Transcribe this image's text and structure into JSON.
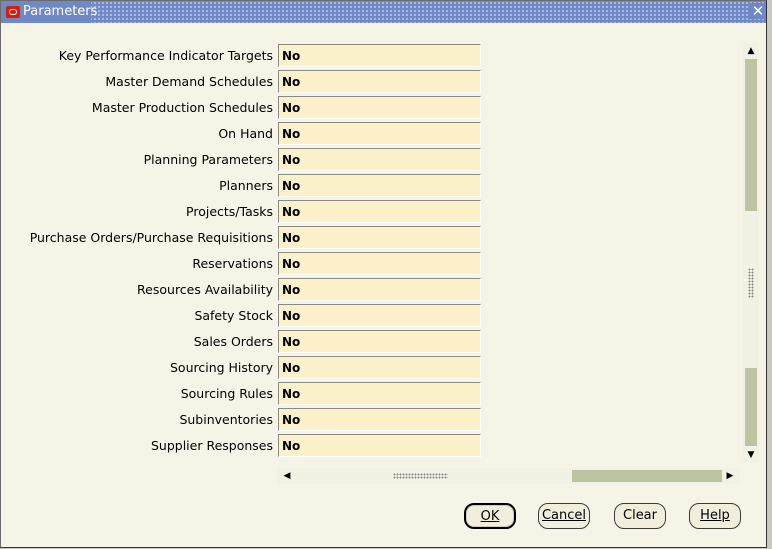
{
  "window": {
    "title": "Parameters"
  },
  "rows": [
    {
      "label": "Key Performance Indicator Targets",
      "value": "No"
    },
    {
      "label": "Master Demand Schedules",
      "value": "No"
    },
    {
      "label": "Master Production Schedules",
      "value": "No"
    },
    {
      "label": "On Hand",
      "value": "No"
    },
    {
      "label": "Planning Parameters",
      "value": "No"
    },
    {
      "label": "Planners",
      "value": "No"
    },
    {
      "label": "Projects/Tasks",
      "value": "No"
    },
    {
      "label": "Purchase Orders/Purchase Requisitions",
      "value": "No"
    },
    {
      "label": "Reservations",
      "value": "No"
    },
    {
      "label": "Resources Availability",
      "value": "No"
    },
    {
      "label": "Safety Stock",
      "value": "No"
    },
    {
      "label": "Sales Orders",
      "value": "No"
    },
    {
      "label": "Sourcing History",
      "value": "No"
    },
    {
      "label": "Sourcing Rules",
      "value": "No"
    },
    {
      "label": "Subinventories",
      "value": "No"
    },
    {
      "label": "Supplier Responses",
      "value": "No"
    }
  ],
  "buttons": {
    "ok": "OK",
    "cancel": "Cancel",
    "clear": "Clear",
    "help": "Help"
  },
  "icons": {
    "app": "oracle-logo-icon",
    "close": "close-icon"
  }
}
